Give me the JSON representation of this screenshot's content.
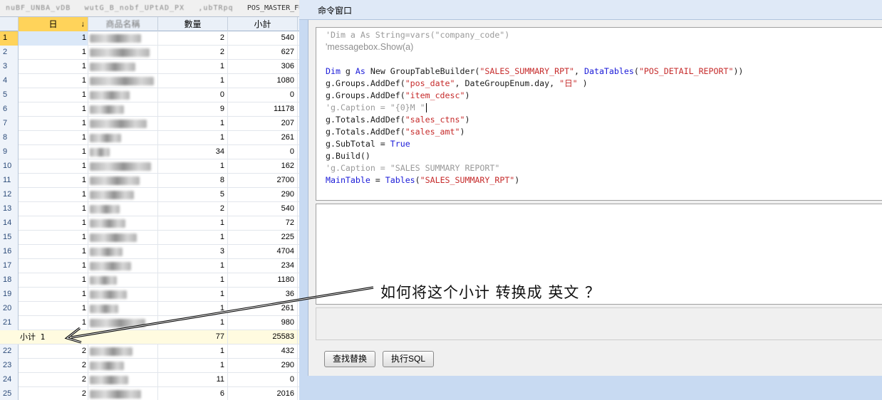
{
  "tabs": [
    "nuBF_UNBA_vDB",
    "wutG_B_nobf_UPtAD_PX",
    ",ubTRpq",
    "POS_MASTER_FUN"
  ],
  "grid": {
    "columns": [
      "日",
      "商品名稱",
      "數量",
      "小計"
    ],
    "sort_indicator": "↓",
    "rows_before": [
      {
        "n": "1",
        "day": "1",
        "qty": "2",
        "amt": "540"
      },
      {
        "n": "2",
        "day": "1",
        "qty": "2",
        "amt": "627"
      },
      {
        "n": "3",
        "day": "1",
        "qty": "1",
        "amt": "306"
      },
      {
        "n": "4",
        "day": "1",
        "qty": "1",
        "amt": "1080"
      },
      {
        "n": "5",
        "day": "1",
        "qty": "0",
        "amt": "0"
      },
      {
        "n": "6",
        "day": "1",
        "qty": "9",
        "amt": "11178"
      },
      {
        "n": "7",
        "day": "1",
        "qty": "1",
        "amt": "207"
      },
      {
        "n": "8",
        "day": "1",
        "qty": "1",
        "amt": "261"
      },
      {
        "n": "9",
        "day": "1",
        "qty": "34",
        "amt": "0"
      },
      {
        "n": "10",
        "day": "1",
        "qty": "1",
        "amt": "162"
      },
      {
        "n": "11",
        "day": "1",
        "qty": "8",
        "amt": "2700"
      },
      {
        "n": "12",
        "day": "1",
        "qty": "5",
        "amt": "290"
      },
      {
        "n": "13",
        "day": "1",
        "qty": "2",
        "amt": "540"
      },
      {
        "n": "14",
        "day": "1",
        "qty": "1",
        "amt": "72"
      },
      {
        "n": "15",
        "day": "1",
        "qty": "1",
        "amt": "225"
      },
      {
        "n": "16",
        "day": "1",
        "qty": "3",
        "amt": "4704"
      },
      {
        "n": "17",
        "day": "1",
        "qty": "1",
        "amt": "234"
      },
      {
        "n": "18",
        "day": "1",
        "qty": "1",
        "amt": "1180"
      },
      {
        "n": "19",
        "day": "1",
        "qty": "1",
        "amt": "36"
      },
      {
        "n": "20",
        "day": "1",
        "qty": "1",
        "amt": "261"
      },
      {
        "n": "21",
        "day": "1",
        "qty": "1",
        "amt": "980"
      }
    ],
    "subtotal": {
      "label": "小计 1",
      "qty": "77",
      "amt": "25583"
    },
    "rows_after": [
      {
        "n": "22",
        "day": "2",
        "qty": "1",
        "amt": "432"
      },
      {
        "n": "23",
        "day": "2",
        "qty": "1",
        "amt": "290"
      },
      {
        "n": "24",
        "day": "2",
        "qty": "11",
        "amt": "0"
      },
      {
        "n": "25",
        "day": "2",
        "qty": "6",
        "amt": "2016"
      }
    ]
  },
  "command_window": {
    "title": "命令窗口",
    "code": {
      "l1": "'Dim a As String=vars(\"company_code\")",
      "l2": "'messagebox.Show(a)",
      "l4_kw1": "Dim",
      "l4_a": " g ",
      "l4_kw2": "As",
      "l4_b": " New GroupTableBuilder(",
      "l4_s1": "\"SALES_SUMMARY_RPT\"",
      "l4_c": ", ",
      "l4_kw3": "DataTables",
      "l4_d": "(",
      "l4_s2": "\"POS_DETAIL_REPORT\"",
      "l4_e": "))",
      "l5_a": "g.Groups.AddDef(",
      "l5_s1": "\"pos_date\"",
      "l5_b": ", DateGroupEnum.day, ",
      "l5_s2": "\"日\"",
      "l5_c": " )",
      "l6_a": "g.Groups.AddDef(",
      "l6_s": "\"item_cdesc\"",
      "l6_b": ")",
      "l7": "'g.Caption = \"{0}M \"",
      "l8_a": "g.Totals.AddDef(",
      "l8_s": "\"sales_ctns\"",
      "l8_b": ")",
      "l9_a": "g.Totals.AddDef(",
      "l9_s": "\"sales_amt\"",
      "l9_b": ")",
      "l10_a": "g.SubTotal = ",
      "l10_kw": "True",
      "l11": "g.Build()",
      "l12": "'g.Caption = \"SALES SUMMARY REPORT\"",
      "l13_kw1": "MainTable",
      "l13_a": " = ",
      "l13_kw2": "Tables",
      "l13_b": "(",
      "l13_s": "\"SALES_SUMMARY_RPT\"",
      "l13_c": ")"
    },
    "buttons": {
      "find_replace": "查找替换",
      "exec_sql": "执行SQL"
    }
  },
  "annotation": "如何将这个小计 转换成 英文 ？",
  "colors": {
    "keyword": "#1b1bd8",
    "string": "#c62b2b",
    "comment": "#9a9a9a",
    "selection": "#ffd35a"
  }
}
